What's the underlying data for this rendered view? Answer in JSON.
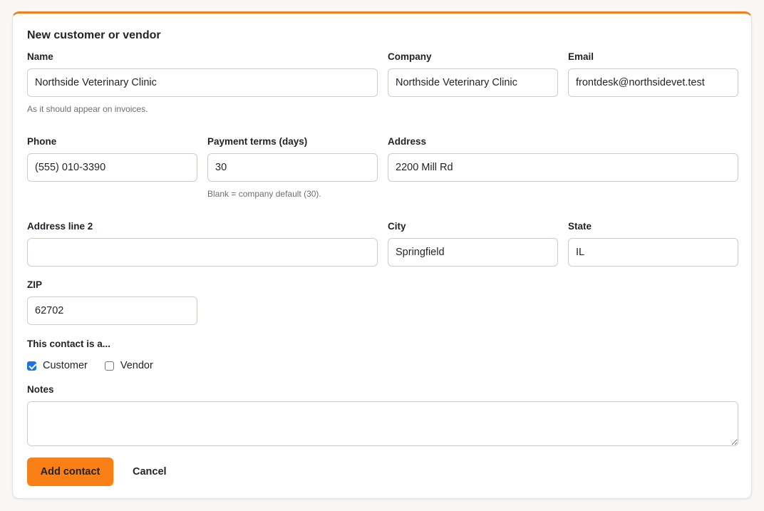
{
  "form": {
    "title": "New customer or vendor",
    "name": {
      "label": "Name",
      "value": "Northside Veterinary Clinic",
      "help": "As it should appear on invoices."
    },
    "company": {
      "label": "Company",
      "value": "Northside Veterinary Clinic"
    },
    "email": {
      "label": "Email",
      "value": "frontdesk@northsidevet.test"
    },
    "phone": {
      "label": "Phone",
      "value": "(555) 010-3390"
    },
    "payment_terms": {
      "label": "Payment terms (days)",
      "value": "30",
      "help": "Blank = company default (30)."
    },
    "address": {
      "label": "Address",
      "value": "2200 Mill Rd"
    },
    "address2": {
      "label": "Address line 2",
      "value": ""
    },
    "city": {
      "label": "City",
      "value": "Springfield"
    },
    "state": {
      "label": "State",
      "value": "IL"
    },
    "zip": {
      "label": "ZIP",
      "value": "62702"
    },
    "contact_type": {
      "label": "This contact is a...",
      "customer": {
        "label": "Customer",
        "checked": true
      },
      "vendor": {
        "label": "Vendor",
        "checked": false
      }
    },
    "notes": {
      "label": "Notes",
      "value": ""
    },
    "submit_label": "Add contact",
    "cancel_label": "Cancel"
  },
  "colors": {
    "accent": "#f97f16",
    "card_top_border": "#f07f1d",
    "checkbox_checked": "#1a73e8"
  }
}
